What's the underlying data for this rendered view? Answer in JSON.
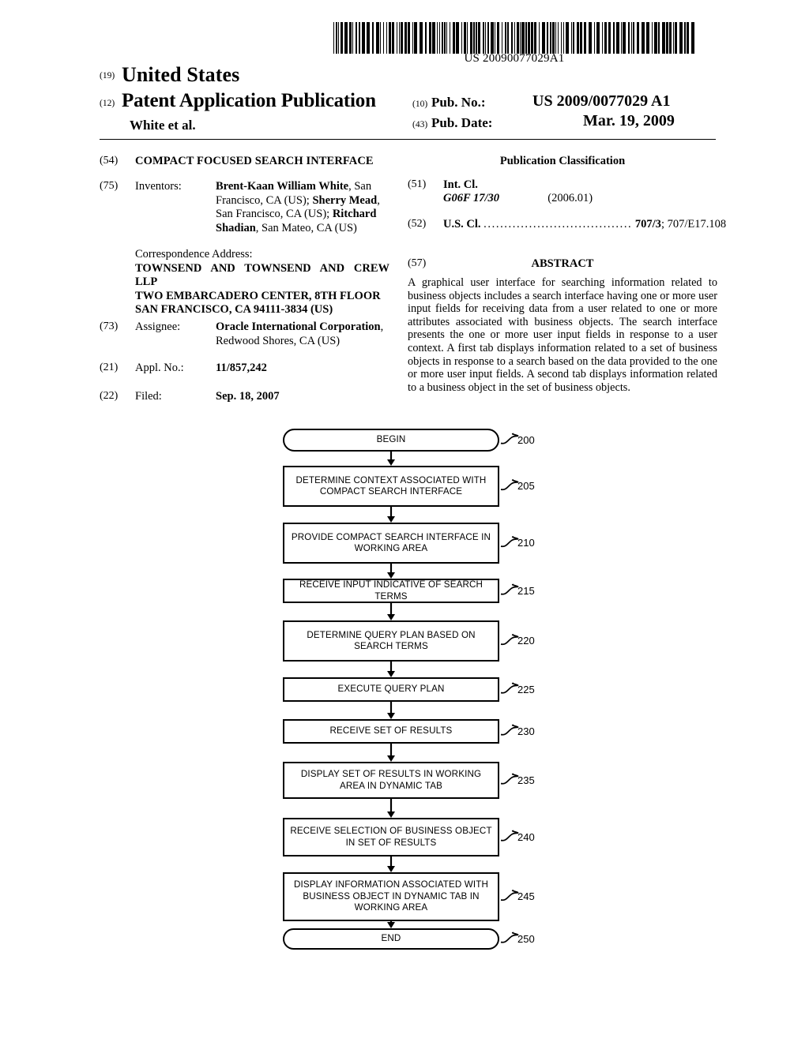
{
  "barcode": {
    "number": "US 20090077029A1"
  },
  "masthead": {
    "code_19": "(19)",
    "country": "United States",
    "code_12": "(12)",
    "doc_type": "Patent Application Publication",
    "authors": "White et al.",
    "code_10": "(10)",
    "pubno_label": "Pub. No.:",
    "pubno_value": "US 2009/0077029 A1",
    "code_43": "(43)",
    "pubdate_label": "Pub. Date:",
    "pubdate_value": "Mar. 19, 2009"
  },
  "left": {
    "title_code": "(54)",
    "title": "COMPACT FOCUSED SEARCH INTERFACE",
    "inventors_code": "(75)",
    "inventors_label": "Inventors:",
    "inventors": [
      {
        "name": "Brent-Kaan William White",
        "place": ", San Francisco, CA (US); "
      },
      {
        "name": "Sherry Mead",
        "place": ", San Francisco, CA (US); "
      },
      {
        "name": "Ritchard Shadian",
        "place": ", San Mateo, CA (US)"
      }
    ],
    "correspondence_label": "Correspondence Address:",
    "correspondence_lines": [
      "TOWNSEND AND TOWNSEND AND CREW",
      "LLP",
      "TWO EMBARCADERO CENTER, 8TH FLOOR",
      "SAN FRANCISCO, CA 94111-3834 (US)"
    ],
    "assignee_code": "(73)",
    "assignee_label": "Assignee:",
    "assignee_name": "Oracle International Corporation",
    "assignee_place": ", Redwood Shores, CA (US)",
    "applno_code": "(21)",
    "applno_label": "Appl. No.:",
    "applno_value": "11/857,242",
    "filed_code": "(22)",
    "filed_label": "Filed:",
    "filed_value": "Sep. 18, 2007"
  },
  "right": {
    "classification_heading": "Publication Classification",
    "intcl_code": "(51)",
    "intcl_label": "Int. Cl.",
    "intcl_value": "G06F 17/30",
    "intcl_date": "(2006.01)",
    "uscl_code": "(52)",
    "uscl_label": "U.S. Cl.",
    "uscl_dots": "....................................",
    "uscl_value_bold": "707/3",
    "uscl_value_rest": "; 707/E17.108",
    "abstract_code": "(57)",
    "abstract_heading": "ABSTRACT",
    "abstract_text": "A graphical user interface for searching information related to business objects includes a search interface having one or more user input fields for receiving data from a user related to one or more attributes associated with business objects. The search interface presents the one or more user input fields in response to a user context. A first tab displays information related to a set of business objects in response to a search based on the data provided to the one or more user input fields. A second tab displays information related to a business object in the set of business objects."
  },
  "flowchart": {
    "nodes": [
      {
        "ref": "200",
        "label": "BEGIN",
        "shape": "terminator"
      },
      {
        "ref": "205",
        "label": "DETERMINE CONTEXT ASSOCIATED WITH COMPACT SEARCH INTERFACE",
        "shape": "process"
      },
      {
        "ref": "210",
        "label": "PROVIDE COMPACT SEARCH INTERFACE IN WORKING AREA",
        "shape": "process"
      },
      {
        "ref": "215",
        "label": "RECEIVE INPUT INDICATIVE OF SEARCH TERMS",
        "shape": "process"
      },
      {
        "ref": "220",
        "label": "DETERMINE QUERY PLAN BASED ON SEARCH TERMS",
        "shape": "process"
      },
      {
        "ref": "225",
        "label": "EXECUTE QUERY PLAN",
        "shape": "process"
      },
      {
        "ref": "230",
        "label": "RECEIVE SET OF RESULTS",
        "shape": "process"
      },
      {
        "ref": "235",
        "label": "DISPLAY SET OF RESULTS IN WORKING AREA IN DYNAMIC TAB",
        "shape": "process"
      },
      {
        "ref": "240",
        "label": "RECEIVE SELECTION OF BUSINESS OBJECT IN SET OF RESULTS",
        "shape": "process"
      },
      {
        "ref": "245",
        "label": "DISPLAY INFORMATION ASSOCIATED WITH BUSINESS OBJECT IN DYNAMIC TAB IN WORKING AREA",
        "shape": "process"
      },
      {
        "ref": "250",
        "label": "END",
        "shape": "terminator"
      }
    ]
  }
}
